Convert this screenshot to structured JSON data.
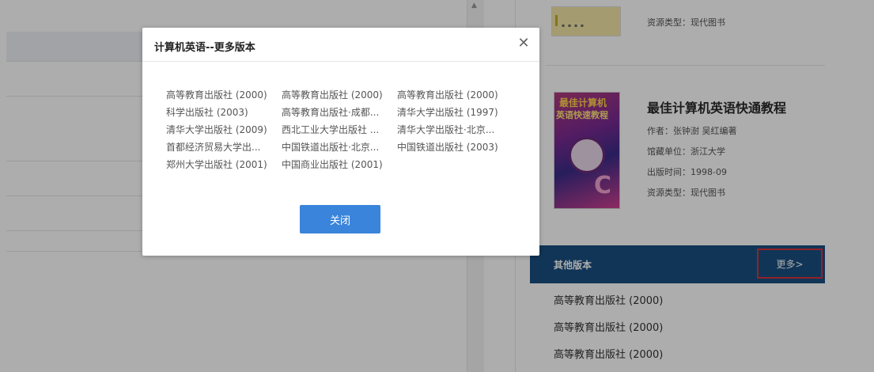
{
  "book_card_top": {
    "resource_type": "资源类型：现代图书"
  },
  "book_card_main": {
    "title": "最佳计算机英语快通教程",
    "author": "作者：张钟澍 吴红编著",
    "library": "馆藏单位：浙江大学",
    "publish_time": "出版时间：1998-09",
    "resource_type": "资源类型：现代图书",
    "cover_text_1": "最佳计算机",
    "cover_text_2": "英语快速教程",
    "cover_letter": "C"
  },
  "other_editions": {
    "header": "其他版本",
    "more_label": "更多>",
    "items": [
      "高等教育出版社 (2000)",
      "高等教育出版社 (2000)",
      "高等教育出版社 (2000)"
    ]
  },
  "modal": {
    "title": "计算机英语--更多版本",
    "close_symbol": "✕",
    "ok_label": "关闭",
    "rows": [
      [
        "高等教育出版社 (2000)",
        "高等教育出版社 (2000)",
        "高等教育出版社 (2000)"
      ],
      [
        "科学出版社 (2003)",
        "高等教育出版社·成都...",
        "清华大学出版社 (1997)"
      ],
      [
        "清华大学出版社 (2009)",
        "西北工业大学出版社 ...",
        "清华大学出版社·北京..."
      ],
      [
        "首都经济贸易大学出...",
        "中国铁道出版社·北京...",
        "中国铁道出版社 (2003)"
      ],
      [
        "郑州大学出版社 (2001)",
        "中国商业出版社 (2001)"
      ]
    ]
  },
  "colors": {
    "header_bg": "#1a4f80",
    "button_bg": "#3a84db",
    "highlight_border": "#d8323b"
  }
}
